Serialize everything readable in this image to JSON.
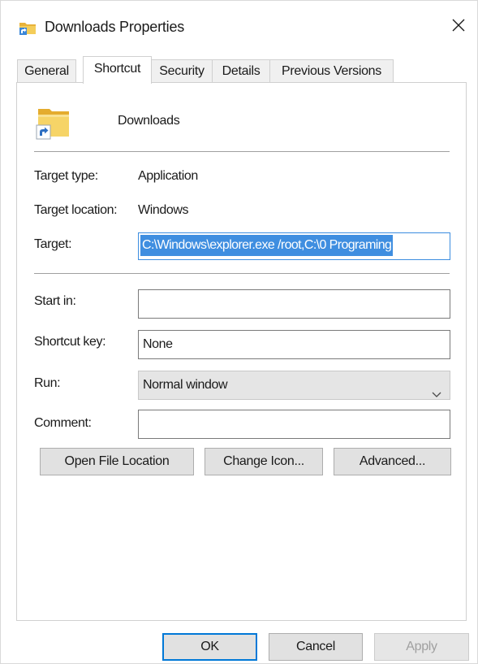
{
  "window": {
    "title": "Downloads Properties"
  },
  "tabs": [
    {
      "label": "General"
    },
    {
      "label": "Shortcut"
    },
    {
      "label": "Security"
    },
    {
      "label": "Details"
    },
    {
      "label": "Previous Versions"
    }
  ],
  "active_tab": "Shortcut",
  "shortcut": {
    "name": "Downloads",
    "target_type_label": "Target type:",
    "target_type_value": "Application",
    "target_location_label": "Target location:",
    "target_location_value": "Windows",
    "target_label": "Target:",
    "target_value": "C:\\Windows\\explorer.exe /root,C:\\0 Programing",
    "start_in_label": "Start in:",
    "start_in_value": "",
    "shortcut_key_label": "Shortcut key:",
    "shortcut_key_value": "None",
    "run_label": "Run:",
    "run_value": "Normal window",
    "comment_label": "Comment:",
    "comment_value": ""
  },
  "buttons": {
    "open_file_location": "Open File Location",
    "change_icon": "Change Icon...",
    "advanced": "Advanced...",
    "ok": "OK",
    "cancel": "Cancel",
    "apply": "Apply"
  },
  "colors": {
    "selection": "#3f8ee0",
    "default_button_border": "#0078d7",
    "folder_yellow": "#f2c44e"
  },
  "icons": {
    "title": "folder-shortcut-icon",
    "close": "close-icon",
    "shortcut": "folder-shortcut-icon",
    "dropdown": "chevron-down-icon"
  }
}
